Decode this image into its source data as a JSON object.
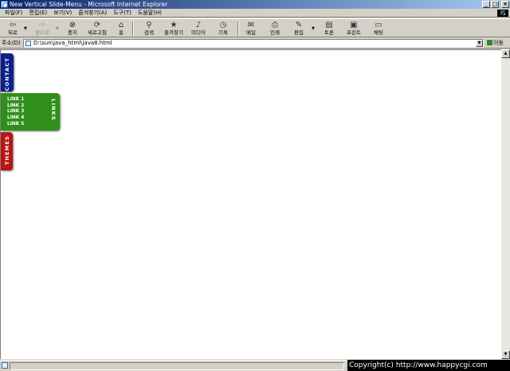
{
  "window": {
    "title": "New Vertical Slide-Menu - Microsoft Internet Explorer",
    "caption_buttons": {
      "minimize": "_",
      "maximize": "□",
      "close": "×"
    }
  },
  "menubar": {
    "items": [
      "파일(F)",
      "편집(E)",
      "보기(V)",
      "즐겨찾기(A)",
      "도구(T)",
      "도움말(H)"
    ]
  },
  "toolbar": {
    "back": "뒤로",
    "forward": "앞으로",
    "stop": "중지",
    "refresh": "새로고침",
    "home": "홈",
    "search": "검색",
    "favorites": "즐겨찾기",
    "media": "미디어",
    "history": "기록",
    "mail": "메일",
    "print": "인쇄",
    "edit": "편집",
    "discuss": "토론",
    "print2": "프린트",
    "messenger": "채팅",
    "icons": {
      "back": "back-arrow-icon",
      "forward": "forward-arrow-icon",
      "stop": "stop-icon",
      "refresh": "refresh-icon",
      "home": "home-icon",
      "search": "search-icon",
      "favorites": "favorites-icon",
      "media": "media-icon",
      "history": "history-icon",
      "mail": "mail-icon",
      "print": "print-icon",
      "edit": "edit-icon",
      "discuss": "discuss-icon",
      "print2": "printer-icon",
      "messenger": "messenger-icon"
    }
  },
  "addressbar": {
    "label": "주소(D)",
    "url": "D:\\sun\\java_html\\java8.html",
    "go_label": "이동"
  },
  "slide_menus": {
    "contact": {
      "label": "CONTACT",
      "color": "#0c1f8a"
    },
    "links": {
      "label": "LINKS",
      "color": "#2f8f1a",
      "items": [
        "LINK 1",
        "LINK 2",
        "LINK 3",
        "LINK 4",
        "LINK 5"
      ]
    },
    "themes": {
      "label": "THEMES",
      "color": "#b51616"
    }
  },
  "footer": {
    "copyright": "Copyright(c) http://www.happycgi.com"
  }
}
